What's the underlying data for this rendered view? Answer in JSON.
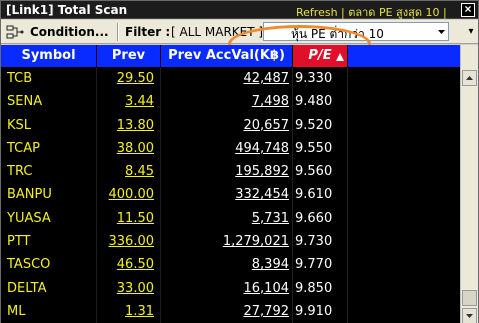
{
  "window": {
    "title": "[Link1] Total Scan",
    "watermark": "Refresh | ตลาด PE สูงสุด 10 |",
    "close_label": "×"
  },
  "toolbar": {
    "condition_label": "Condition...",
    "filter_label": "Filter :",
    "market_value": "[ ALL MARKET ]",
    "selected_scan": "หุ้น PE ต่ำกว่า 10",
    "overflow_label": "▾"
  },
  "columns": {
    "symbol": "Symbol",
    "prev": "Prev",
    "prev_acc_val": "Prev AccVal(K฿)",
    "pe": "P/E"
  },
  "rows": [
    {
      "symbol": "TCB",
      "prev": "29.50",
      "acc": "42,487",
      "pe": "9.330"
    },
    {
      "symbol": "SENA",
      "prev": "3.44",
      "acc": "7,498",
      "pe": "9.480"
    },
    {
      "symbol": "KSL",
      "prev": "13.80",
      "acc": "20,657",
      "pe": "9.520"
    },
    {
      "symbol": "TCAP",
      "prev": "38.00",
      "acc": "494,748",
      "pe": "9.550"
    },
    {
      "symbol": "TRC",
      "prev": "8.45",
      "acc": "195,892",
      "pe": "9.560"
    },
    {
      "symbol": "BANPU",
      "prev": "400.00",
      "acc": "332,454",
      "pe": "9.610"
    },
    {
      "symbol": "YUASA",
      "prev": "11.50",
      "acc": "5,731",
      "pe": "9.660"
    },
    {
      "symbol": "PTT",
      "prev": "336.00",
      "acc": "1,279,021",
      "pe": "9.730"
    },
    {
      "symbol": "TASCO",
      "prev": "46.50",
      "acc": "8,394",
      "pe": "9.770"
    },
    {
      "symbol": "DELTA",
      "prev": "33.00",
      "acc": "16,104",
      "pe": "9.850"
    },
    {
      "symbol": "ML",
      "prev": "1.31",
      "acc": "27,792",
      "pe": "9.910"
    }
  ],
  "colors": {
    "header_bg": "#0a2bff",
    "pe_header_bg": "#e0102a",
    "symbol_text": "#f4f020",
    "grid_bg": "#000000",
    "callout": "#f08a2a"
  },
  "icons": [
    "condition-icon",
    "dropdown-arrow-icon",
    "sort-ascending-icon",
    "close-icon",
    "scroll-up-icon",
    "scroll-down-icon"
  ]
}
